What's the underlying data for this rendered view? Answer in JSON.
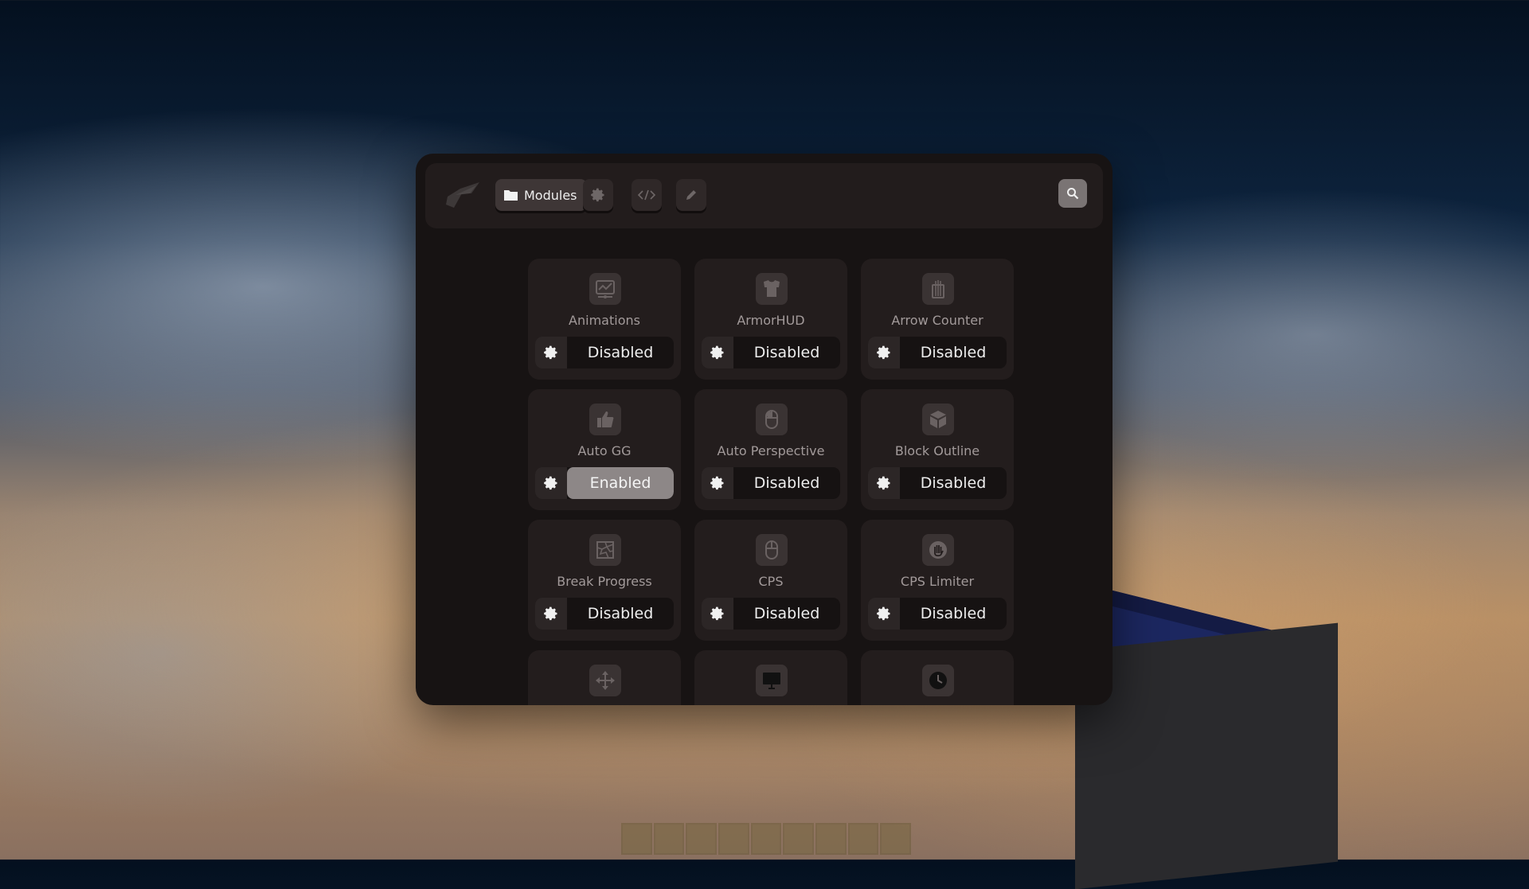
{
  "window": {
    "title": "Modules"
  },
  "header": {
    "tabs": [
      {
        "label": "Modules",
        "icon": "folder-icon",
        "active": true
      },
      {
        "label": "",
        "icon": "gear-icon",
        "active": false
      },
      {
        "label": "",
        "icon": "code-icon",
        "active": false
      },
      {
        "label": "",
        "icon": "pencil-icon",
        "active": false
      }
    ],
    "search_icon": "search-icon"
  },
  "modules": [
    {
      "name": "Animations",
      "icon": "animations-icon",
      "state": "Disabled"
    },
    {
      "name": "ArmorHUD",
      "icon": "chestplate-icon",
      "state": "Disabled"
    },
    {
      "name": "Arrow Counter",
      "icon": "arrows-icon",
      "state": "Disabled"
    },
    {
      "name": "Auto GG",
      "icon": "thumbs-up-icon",
      "state": "Enabled"
    },
    {
      "name": "Auto Perspective",
      "icon": "mouse-icon",
      "state": "Disabled"
    },
    {
      "name": "Block Outline",
      "icon": "cube-icon",
      "state": "Disabled"
    },
    {
      "name": "Break Progress",
      "icon": "break-icon",
      "state": "Disabled"
    },
    {
      "name": "CPS",
      "icon": "mouse-icon",
      "state": "Disabled"
    },
    {
      "name": "CPS Limiter",
      "icon": "hand-icon",
      "state": "Disabled"
    },
    {
      "name": "",
      "icon": "move-icon",
      "state": ""
    },
    {
      "name": "",
      "icon": "monitor-icon",
      "state": ""
    },
    {
      "name": "",
      "icon": "clock-icon",
      "state": ""
    }
  ],
  "colors": {
    "panel": "#171313",
    "card": "#231d1d",
    "enabled": "#8d8787",
    "accent_text": "#eeeeee"
  }
}
